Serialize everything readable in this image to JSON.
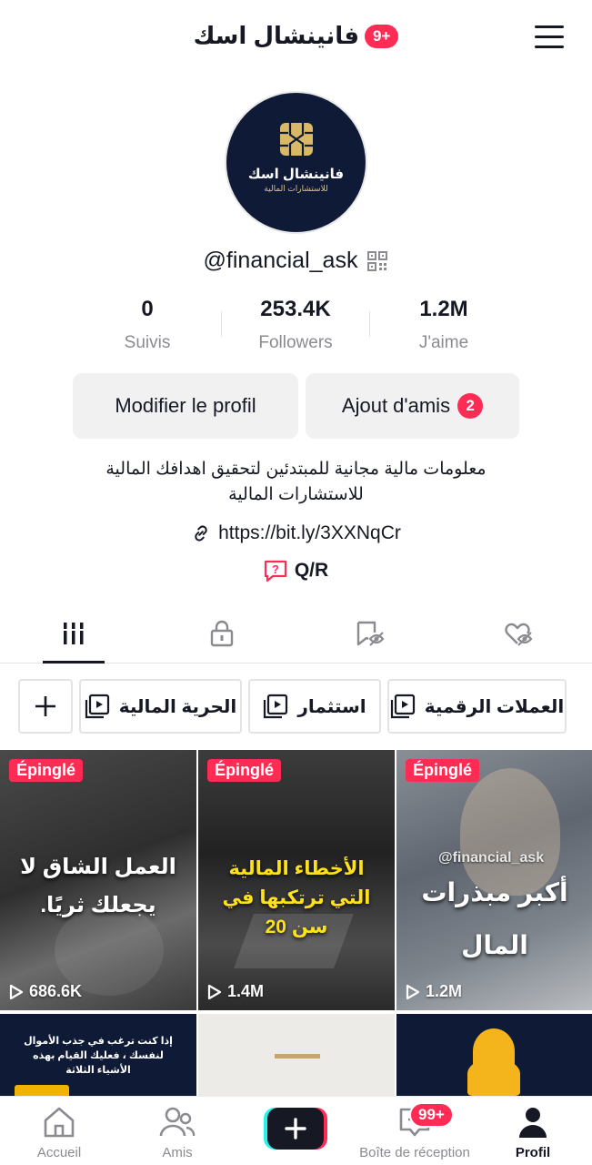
{
  "header": {
    "title": "فانينشال اسك",
    "notifications_badge": "9+"
  },
  "avatar": {
    "name": "فانينشال اسك",
    "subtitle": "للاستشارات المالية"
  },
  "profile": {
    "username": "@financial_ask"
  },
  "stats": [
    {
      "value": "0",
      "label": "Suivis"
    },
    {
      "value": "253.4K",
      "label": "Followers"
    },
    {
      "value": "1.2M",
      "label": "J'aime"
    }
  ],
  "actions": {
    "edit_label": "Modifier le profil",
    "add_friends_label": "Ajout d'amis",
    "add_friends_count": "2"
  },
  "bio": {
    "line1": "معلومات مالية مجانية للمبتدئين لتحقيق اهدافك المالية",
    "line2": "للاستشارات المالية",
    "link": "https://bit.ly/3XXNqCr",
    "qa_label": "Q/R"
  },
  "tabs": [
    "videos",
    "private",
    "reposts",
    "liked"
  ],
  "playlists": [
    {
      "label": "العملات الرقمية"
    },
    {
      "label": "استثمار"
    },
    {
      "label": "الحرية المالية"
    }
  ],
  "videos": [
    {
      "pinned": "Épinglé",
      "views": "686.6K",
      "text": "العمل الشاق لا يجعلك ثريًا."
    },
    {
      "pinned": "Épinglé",
      "views": "1.4M",
      "text": "الأخطاء المالية التي ترتكبها في سن 20"
    },
    {
      "pinned": "Épinglé",
      "views": "1.2M",
      "watermark": "@financial_ask",
      "text": "أكبر مبذرات المال"
    },
    {
      "text": "إذا كنت ترغب في جذب الأموال لنفسك ، فعليك القيام بهذه الأشياء الثلاثة"
    },
    {},
    {}
  ],
  "bottom_nav": {
    "home": "Accueil",
    "friends": "Amis",
    "inbox": "Boîte de réception",
    "inbox_badge": "99+",
    "profile": "Profil"
  },
  "colors": {
    "accent": "#fe2c55",
    "text": "#161823",
    "muted": "#8a8b91"
  }
}
